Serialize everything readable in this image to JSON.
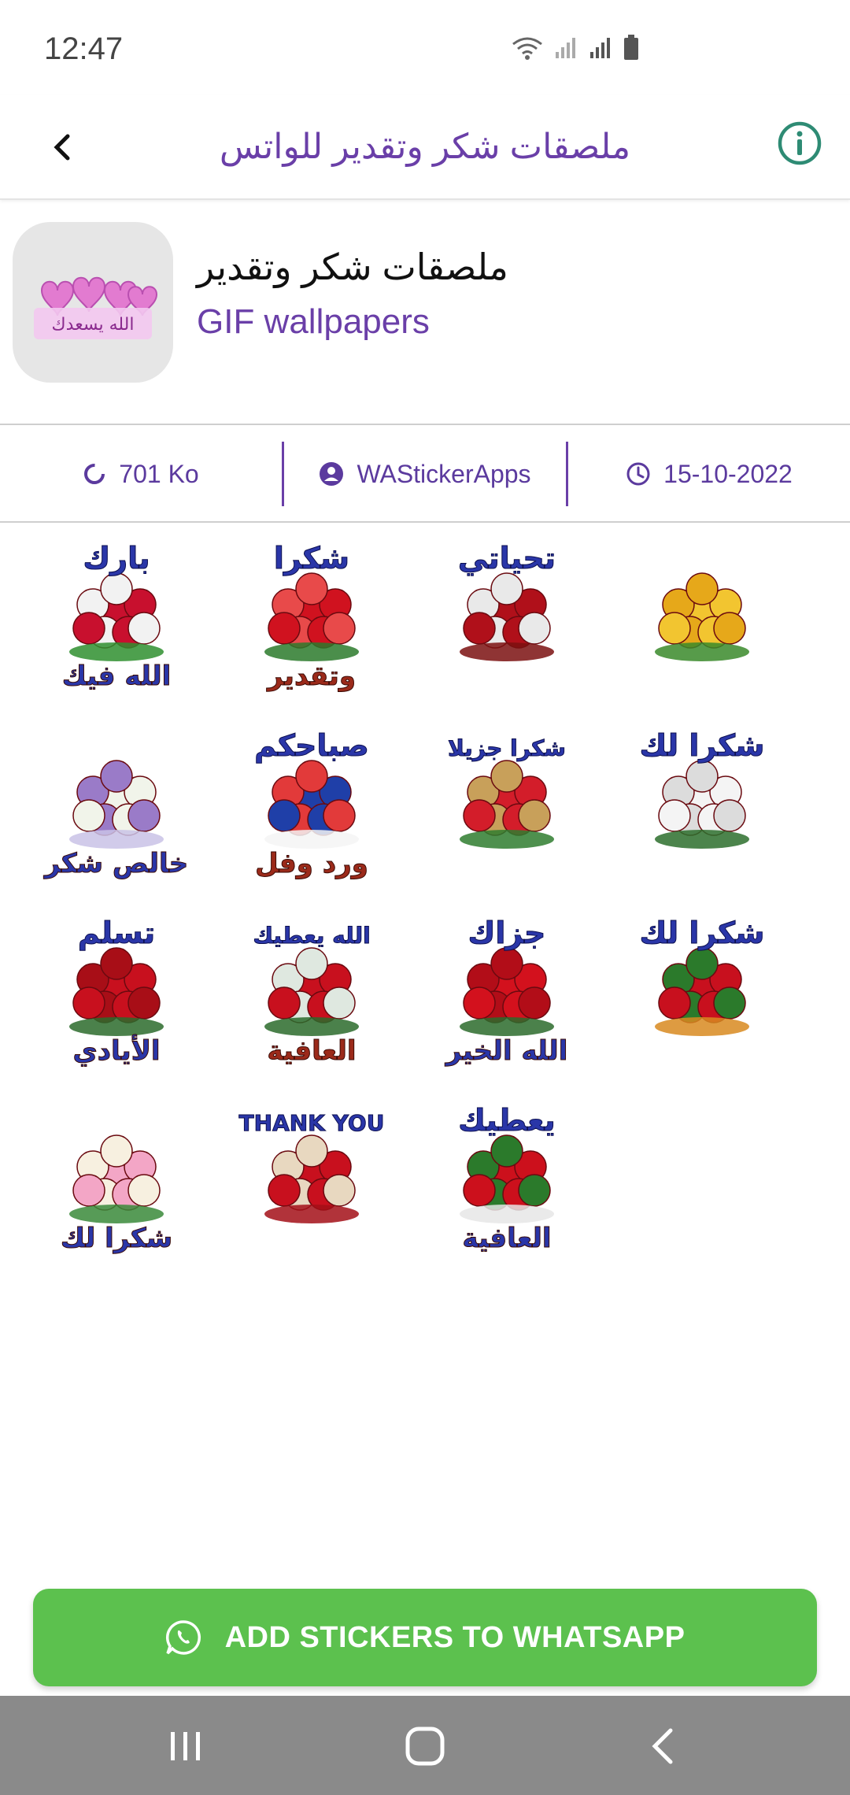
{
  "status_bar": {
    "time": "12:47"
  },
  "app_bar": {
    "title": "ملصقات شكر وتقدير للواتس"
  },
  "pack": {
    "name": "ملصقات شكر وتقدير",
    "publisher": "GIF wallpapers",
    "thumb_text": "الله يسعدك"
  },
  "info": {
    "size": "701 Ko",
    "author": "WAStickerApps",
    "date": "15-10-2022"
  },
  "stickers": [
    {
      "text1": "بارك",
      "text2": "الله فيك",
      "kind": "bouquet"
    },
    {
      "text1": "شكرا",
      "text2": "وتقدير",
      "kind": "rose"
    },
    {
      "text1": "تحياتي",
      "text2": "",
      "kind": "heart"
    },
    {
      "text1": "",
      "text2": "",
      "kind": "yellow"
    },
    {
      "text1": "",
      "text2": "خالص شكر",
      "kind": "white-bouquet"
    },
    {
      "text1": "صباحكم",
      "text2": "ورد وفل",
      "kind": "mixed"
    },
    {
      "text1": "شكرا جزيلا",
      "text2": "",
      "kind": "basket"
    },
    {
      "text1": "شكرا لك",
      "text2": "",
      "kind": "white-rose"
    },
    {
      "text1": "تسلم",
      "text2": "الأيادي",
      "kind": "heart-red"
    },
    {
      "text1": "الله يعطيك",
      "text2": "العافية",
      "kind": "vases"
    },
    {
      "text1": "جزاك",
      "text2": "الله الخير",
      "kind": "red-mound"
    },
    {
      "text1": "شكرا لك",
      "text2": "",
      "kind": "side-roses"
    },
    {
      "text1": "",
      "text2": "شكرا لك",
      "kind": "pink-bouquet"
    },
    {
      "text1": "THANK YOU",
      "text2": "",
      "kind": "vase"
    },
    {
      "text1": "يعطيك",
      "text2": "العافية",
      "kind": "single-rose"
    }
  ],
  "add_button": {
    "label": "ADD STICKERS TO WHATSAPP"
  },
  "colors": {
    "accent": "#6a3fa8",
    "green": "#5cc14e",
    "nav": "#8a8a8a"
  }
}
